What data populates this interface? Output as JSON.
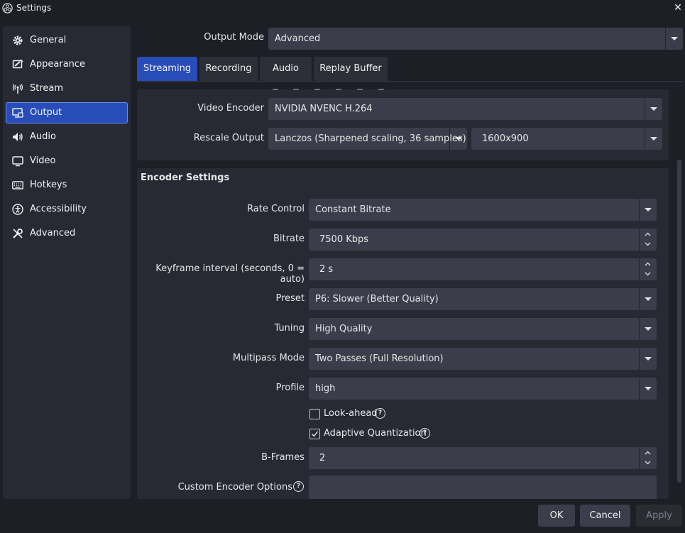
{
  "window": {
    "title": "Settings",
    "close_glyph": "✕"
  },
  "sidebar": {
    "items": [
      {
        "label": "General",
        "icon": "gear-icon"
      },
      {
        "label": "Appearance",
        "icon": "appearance-icon"
      },
      {
        "label": "Stream",
        "icon": "antenna-icon"
      },
      {
        "label": "Output",
        "icon": "output-icon",
        "active": true
      },
      {
        "label": "Audio",
        "icon": "speaker-icon"
      },
      {
        "label": "Video",
        "icon": "monitor-icon"
      },
      {
        "label": "Hotkeys",
        "icon": "keyboard-icon"
      },
      {
        "label": "Accessibility",
        "icon": "accessibility-icon"
      },
      {
        "label": "Advanced",
        "icon": "wrench-icon"
      }
    ]
  },
  "output_mode": {
    "label": "Output Mode",
    "value": "Advanced"
  },
  "tabs": [
    {
      "label": "Streaming",
      "active": true
    },
    {
      "label": "Recording"
    },
    {
      "label": "Audio"
    },
    {
      "label": "Replay Buffer"
    }
  ],
  "top_panel": {
    "video_encoder": {
      "label": "Video Encoder",
      "value": "NVIDIA NVENC H.264"
    },
    "rescale_output": {
      "label": "Rescale Output",
      "filter": "Lanczos (Sharpened scaling, 36 samples)",
      "resolution": "1600x900"
    }
  },
  "encoder_settings": {
    "heading": "Encoder Settings",
    "rate_control": {
      "label": "Rate Control",
      "value": "Constant Bitrate"
    },
    "bitrate": {
      "label": "Bitrate",
      "value": "7500 Kbps"
    },
    "keyframe": {
      "label": "Keyframe interval (seconds, 0 = auto)",
      "value": "2 s"
    },
    "preset": {
      "label": "Preset",
      "value": "P6: Slower (Better Quality)"
    },
    "tuning": {
      "label": "Tuning",
      "value": "High Quality"
    },
    "multipass": {
      "label": "Multipass Mode",
      "value": "Two Passes (Full Resolution)"
    },
    "profile": {
      "label": "Profile",
      "value": "high"
    },
    "lookahead": {
      "label": "Look-ahead",
      "checked": false
    },
    "adaptive_quant": {
      "label": "Adaptive Quantization",
      "checked": true
    },
    "bframes": {
      "label": "B-Frames",
      "value": "2"
    },
    "custom_options": {
      "label": "Custom Encoder Options",
      "value": ""
    }
  },
  "footer": {
    "ok": "OK",
    "cancel": "Cancel",
    "apply": "Apply"
  },
  "colors": {
    "accent": "#284cb8",
    "background": "#1d1f26",
    "panel": "#272a33",
    "control": "#3b3e4a"
  }
}
